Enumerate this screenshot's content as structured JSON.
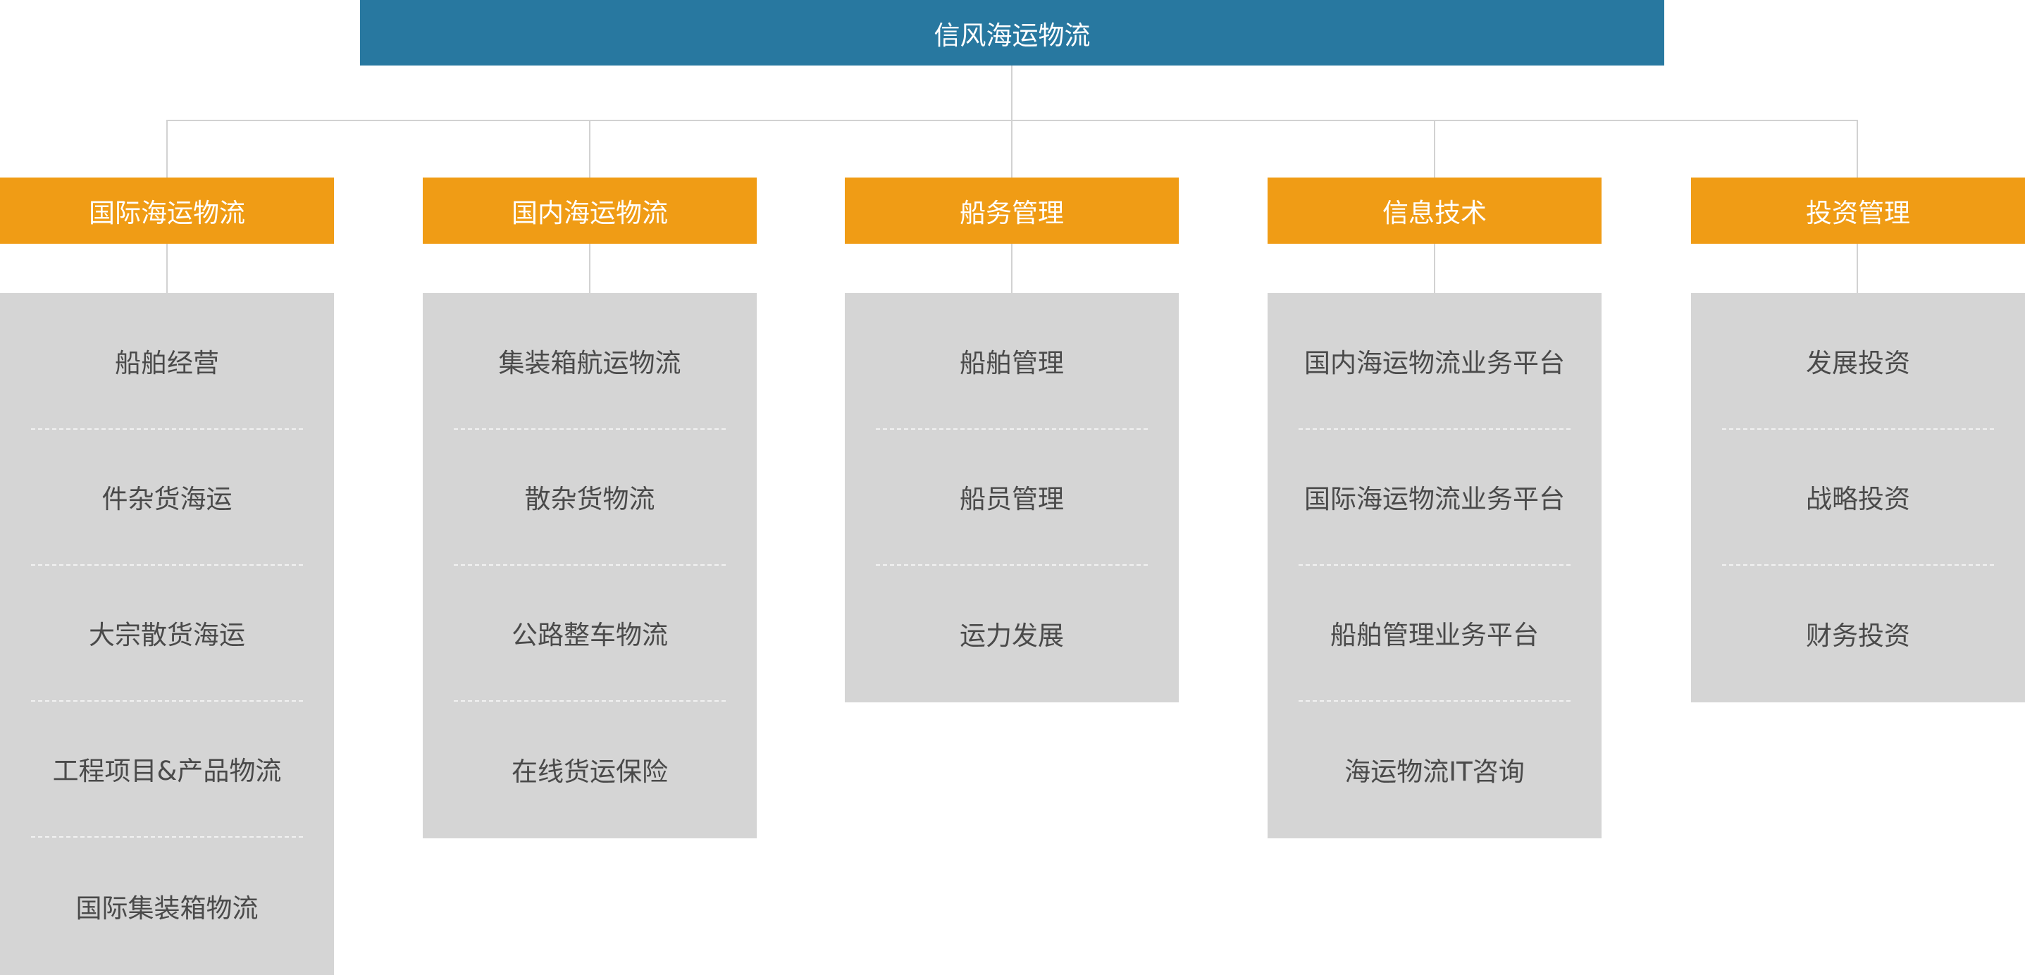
{
  "root": {
    "label": "信风海运物流"
  },
  "colors": {
    "root_bg": "#2878a0",
    "dept_bg": "#f09c15",
    "panel_bg": "#d5d5d5",
    "connector": "#d2d2d2"
  },
  "departments": [
    {
      "label": "国际海运物流",
      "items": [
        "船舶经营",
        "件杂货海运",
        "大宗散货海运",
        "工程项目&产品物流",
        "国际集装箱物流"
      ]
    },
    {
      "label": "国内海运物流",
      "items": [
        "集装箱航运物流",
        "散杂货物流",
        "公路整车物流",
        "在线货运保险"
      ]
    },
    {
      "label": "船务管理",
      "items": [
        "船舶管理",
        "船员管理",
        "运力发展"
      ]
    },
    {
      "label": "信息技术",
      "items": [
        "国内海运物流业务平台",
        "国际海运物流业务平台",
        "船舶管理业务平台",
        "海运物流IT咨询"
      ]
    },
    {
      "label": "投资管理",
      "items": [
        "发展投资",
        "战略投资",
        "财务投资"
      ]
    }
  ]
}
